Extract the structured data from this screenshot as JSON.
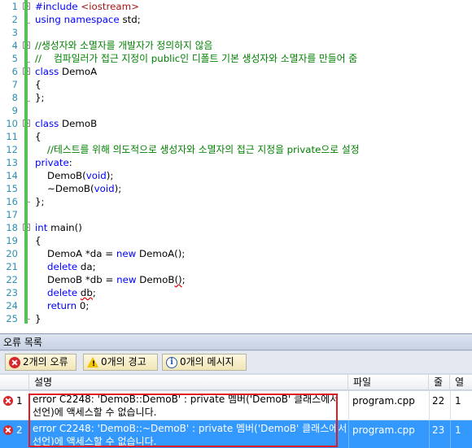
{
  "editor": {
    "lines": [
      {
        "n": "1",
        "tokens": [
          {
            "t": "#include ",
            "c": "pp"
          },
          {
            "t": "<iostream>",
            "c": "inc"
          }
        ]
      },
      {
        "n": "2",
        "tokens": [
          {
            "t": "using namespace ",
            "c": "kw"
          },
          {
            "t": "std;",
            "c": ""
          }
        ]
      },
      {
        "n": "3",
        "tokens": []
      },
      {
        "n": "4",
        "tokens": [
          {
            "t": "//생성자와 소멸자를 개발자가 정의하지 않음",
            "c": "cm"
          }
        ]
      },
      {
        "n": "5",
        "tokens": [
          {
            "t": "//    컴파일러가 접근 지정이 public인 디폴트 기본 생성자와 소멸자를 만들어 줌",
            "c": "cm"
          }
        ]
      },
      {
        "n": "6",
        "tokens": [
          {
            "t": "class ",
            "c": "kw"
          },
          {
            "t": "DemoA",
            "c": ""
          }
        ]
      },
      {
        "n": "7",
        "tokens": [
          {
            "t": "{",
            "c": ""
          }
        ]
      },
      {
        "n": "8",
        "tokens": [
          {
            "t": "};",
            "c": ""
          }
        ]
      },
      {
        "n": "9",
        "tokens": []
      },
      {
        "n": "10",
        "tokens": [
          {
            "t": "class ",
            "c": "kw"
          },
          {
            "t": "DemoB",
            "c": ""
          }
        ]
      },
      {
        "n": "11",
        "tokens": [
          {
            "t": "{",
            "c": ""
          }
        ]
      },
      {
        "n": "12",
        "tokens": [
          {
            "t": "    //테스트를 위해 의도적으로 생성자와 소멸자의 접근 지정을 private으로 설정",
            "c": "cm"
          }
        ]
      },
      {
        "n": "13",
        "tokens": [
          {
            "t": "private",
            "c": "kw"
          },
          {
            "t": ":",
            "c": ""
          }
        ]
      },
      {
        "n": "14",
        "tokens": [
          {
            "t": "    DemoB(",
            "c": ""
          },
          {
            "t": "void",
            "c": "kw"
          },
          {
            "t": ");",
            "c": ""
          }
        ]
      },
      {
        "n": "15",
        "tokens": [
          {
            "t": "    ~DemoB(",
            "c": ""
          },
          {
            "t": "void",
            "c": "kw"
          },
          {
            "t": ");",
            "c": ""
          }
        ]
      },
      {
        "n": "16",
        "tokens": [
          {
            "t": "};",
            "c": ""
          }
        ]
      },
      {
        "n": "17",
        "tokens": []
      },
      {
        "n": "18",
        "tokens": [
          {
            "t": "int ",
            "c": "kw"
          },
          {
            "t": "main()",
            "c": ""
          }
        ]
      },
      {
        "n": "19",
        "tokens": [
          {
            "t": "{",
            "c": ""
          }
        ]
      },
      {
        "n": "20",
        "tokens": [
          {
            "t": "    DemoA *da = ",
            "c": ""
          },
          {
            "t": "new ",
            "c": "kw"
          },
          {
            "t": "DemoA();",
            "c": ""
          }
        ]
      },
      {
        "n": "21",
        "tokens": [
          {
            "t": "    ",
            "c": ""
          },
          {
            "t": "delete ",
            "c": "kw"
          },
          {
            "t": "da;",
            "c": ""
          }
        ]
      },
      {
        "n": "22",
        "tokens": [
          {
            "t": "    DemoB *db = ",
            "c": ""
          },
          {
            "t": "new ",
            "c": "kw"
          },
          {
            "t": "DemoB",
            "c": ""
          },
          {
            "t": "()",
            "c": "squig"
          },
          {
            "t": ";",
            "c": ""
          }
        ]
      },
      {
        "n": "23",
        "tokens": [
          {
            "t": "    ",
            "c": ""
          },
          {
            "t": "delete ",
            "c": "kw"
          },
          {
            "t": "db",
            "c": "squig"
          },
          {
            "t": ";",
            "c": ""
          }
        ]
      },
      {
        "n": "24",
        "tokens": [
          {
            "t": "    ",
            "c": ""
          },
          {
            "t": "return ",
            "c": "kw"
          },
          {
            "t": "0;",
            "c": ""
          }
        ]
      },
      {
        "n": "25",
        "tokens": [
          {
            "t": "}",
            "c": ""
          }
        ]
      }
    ]
  },
  "error_list": {
    "title": "오류 목록",
    "filters": {
      "errors_label": "2개의 오류",
      "warnings_label": "0개의 경고",
      "messages_label": "0개의 메시지"
    },
    "columns": {
      "description": "설명",
      "file": "파일",
      "line": "줄",
      "column": "열"
    },
    "rows": [
      {
        "index": "1",
        "description": "error C2248: 'DemoB::DemoB' : private 멤버('DemoB' 클래스에서\n선언)에 액세스할 수 없습니다.",
        "file": "program.cpp",
        "line": "22",
        "column": "1"
      },
      {
        "index": "2",
        "description": "error C2248: 'DemoB::~DemoB' : private 멤버('DemoB' 클래스에서\n선언)에 액세스할 수 없습니다.",
        "file": "program.cpp",
        "line": "23",
        "column": "1"
      }
    ]
  },
  "colors": {
    "keyword": "#0000ff",
    "comment": "#008000",
    "include": "#a31515",
    "selected_row": "#3399ff",
    "highlight_box": "#e01b24"
  }
}
